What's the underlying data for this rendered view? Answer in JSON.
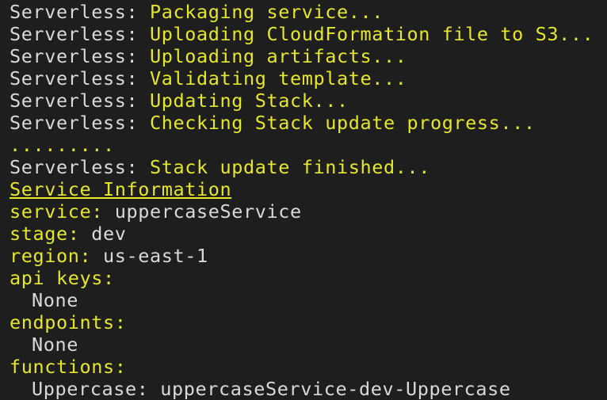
{
  "colors": {
    "background": "#1e1e1e",
    "prefix_text": "#d9d9d9",
    "highlight_text": "#e6e62a"
  },
  "log": {
    "prefix": "Serverless: ",
    "lines": [
      "Packaging service...",
      "Uploading CloudFormation file to S3...",
      "Uploading artifacts...",
      "Validating template...",
      "Updating Stack...",
      "Checking Stack update progress..."
    ],
    "progress_dots": ".........",
    "finished": "Stack update finished..."
  },
  "service_info": {
    "heading": "Service Information",
    "service_label": "service:",
    "service_value": " uppercaseService",
    "stage_label": "stage:",
    "stage_value": " dev",
    "region_label": "region:",
    "region_value": " us-east-1",
    "api_keys_label": "api keys:",
    "api_keys_value": "None",
    "endpoints_label": "endpoints:",
    "endpoints_value": "None",
    "functions_label": "functions:",
    "function_name": "Uppercase:",
    "function_value": " uppercaseService-dev-Uppercase"
  }
}
